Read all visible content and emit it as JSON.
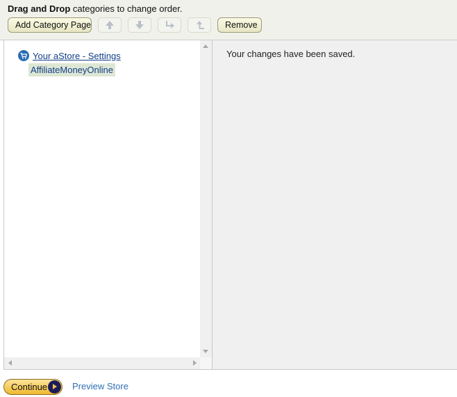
{
  "toolbar": {
    "instruction_bold": "Drag and Drop",
    "instruction_rest": " categories to change order.",
    "add_category_label": "Add Category Page",
    "remove_label": "Remove",
    "icons": [
      "arrow-up-icon",
      "arrow-down-icon",
      "indent-icon",
      "outdent-icon"
    ]
  },
  "tree": {
    "root_label": "Your aStore - Settings",
    "root_icon": "cart-icon",
    "items": [
      {
        "label": "AffiliateMoneyOnline"
      }
    ]
  },
  "content": {
    "status_message": "Your changes have been saved."
  },
  "footer": {
    "continue_label": "Continue",
    "preview_label": "Preview Store"
  },
  "colors": {
    "toolbar_bg": "#f1f1ec",
    "link": "#123e87",
    "selected_item_bg": "#dde7d4",
    "continue_button": "#f0b92f",
    "preview_link": "#2f6fb3"
  }
}
